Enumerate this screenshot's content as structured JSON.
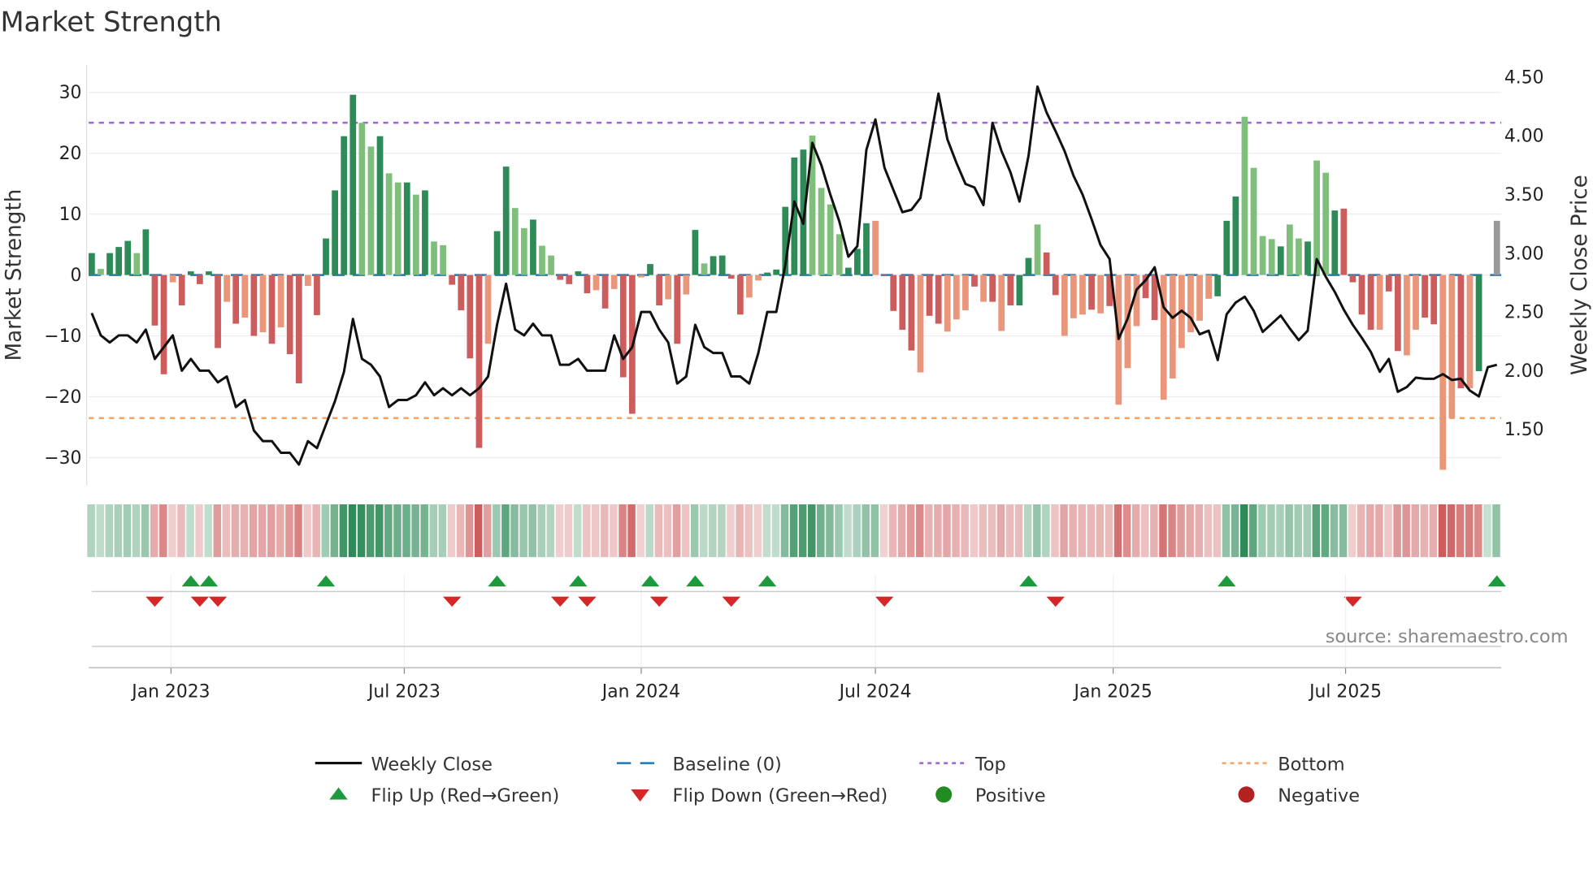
{
  "chart_data": {
    "type": "bar",
    "title": "Market Strength",
    "ylabel": "Market Strength",
    "y2label": "Weekly Close Price",
    "ylim": [
      -35,
      32
    ],
    "y2lim": [
      1.1,
      4.6
    ],
    "y_ticks": [
      "30",
      "20",
      "10",
      "0",
      "−10",
      "−20",
      "−30"
    ],
    "y_tick_values": [
      30,
      20,
      10,
      0,
      -10,
      -20,
      -30
    ],
    "y2_ticks": [
      "4.50",
      "4.00",
      "3.50",
      "3.00",
      "2.50",
      "2.00",
      "1.50"
    ],
    "y2_tick_values": [
      4.5,
      4.0,
      3.5,
      3.0,
      2.5,
      2.0,
      1.5
    ],
    "x_ticks": [
      {
        "label": "Jan 2023",
        "week": 8.8
      },
      {
        "label": "Jul 2023",
        "week": 34.7
      },
      {
        "label": "Jan 2024",
        "week": 61.0
      },
      {
        "label": "Jul 2024",
        "week": 87.0
      },
      {
        "label": "Jan 2025",
        "week": 113.4
      },
      {
        "label": "Jul 2025",
        "week": 139.2
      }
    ],
    "top_level": 25,
    "bottom_level": -23.5,
    "baseline": 0,
    "strength": [
      3.6,
      1.0,
      3.6,
      4.6,
      5.6,
      3.6,
      7.5,
      -8.3,
      -16.3,
      -1.2,
      -5,
      0.6,
      -1.5,
      0.6,
      -12,
      -4.4,
      -8,
      -7,
      -10,
      -9.4,
      -11.3,
      -8.6,
      -13,
      -17.8,
      -1.8,
      -6.6,
      6,
      13.9,
      22.8,
      29.6,
      25,
      21.1,
      22.8,
      16.7,
      15.2,
      15.2,
      13.2,
      13.9,
      5.5,
      4.9,
      -1.6,
      -5.8,
      -13.7,
      -28.4,
      -11.3,
      7.2,
      17.8,
      11,
      7.7,
      9.1,
      4.8,
      3.2,
      -0.8,
      -1.5,
      0.6,
      -3,
      -2.5,
      -5.5,
      -2.3,
      -16.8,
      -22.8,
      -0.4,
      1.8,
      -5,
      -4,
      -11.3,
      -3.2,
      7.4,
      1.9,
      3.1,
      3.2,
      -0.6,
      -6.5,
      -3.7,
      -0.9,
      0.4,
      0.9,
      11.2,
      19.3,
      20.6,
      22.9,
      14.3,
      11.6,
      6.7,
      1.2,
      4.3,
      8.5,
      8.9,
      -0.2,
      -5.9,
      -9,
      -12.4,
      -16,
      -6.7,
      -8,
      -9.3,
      -7.3,
      -5.8,
      -1.9,
      -4.4,
      -4.4,
      -9.2,
      -5,
      -5,
      2.8,
      8.3,
      3.7,
      -3.3,
      -10,
      -7.1,
      -6.5,
      -5.7,
      -6.3,
      -5.1,
      -21.3,
      -15.3,
      -8.4,
      -3.8,
      -7.4,
      -20.5,
      -17,
      -12,
      -9.4,
      -7.5,
      -3.9,
      -3.5,
      8.9,
      12.9,
      26,
      17.6,
      6.4,
      5.9,
      4.7,
      8.3,
      6,
      5.5,
      18.8,
      16.8,
      10.6,
      10.9,
      -1.2,
      -6.5,
      -9,
      -9,
      -2.7,
      -12.5,
      -13.2,
      -9,
      -7,
      -8.1,
      -32,
      -23.5,
      -18.6,
      -18.6,
      -15.8,
      0,
      8.9
    ],
    "bar_shade": "DLDDDLDRRSRDRDRSRSRSRSRRSRDDDDLLDLLDLDLLRRRRSDDLLDLLRRDRSRSRRSDRSRSDLDDRRSSDDDDDLLLLDDDSRRRRSRRSSSRSRSRDDLRRSSSRSRSSSRRSSSSSSDDDLLLLDLLDLLDRRRRSRRSSRRSSRSD",
    "weekly_close": [
      2.49,
      2.3,
      2.24,
      2.3,
      2.3,
      2.24,
      2.35,
      2.1,
      2.2,
      2.3,
      2.0,
      2.1,
      2.0,
      2.0,
      1.9,
      1.95,
      1.69,
      1.75,
      1.49,
      1.4,
      1.4,
      1.3,
      1.3,
      1.2,
      1.4,
      1.34,
      1.54,
      1.74,
      1.99,
      2.44,
      2.1,
      2.05,
      1.95,
      1.69,
      1.75,
      1.75,
      1.79,
      1.9,
      1.79,
      1.85,
      1.79,
      1.85,
      1.79,
      1.85,
      1.95,
      2.39,
      2.74,
      2.35,
      2.3,
      2.4,
      2.3,
      2.3,
      2.05,
      2.05,
      2.1,
      2.0,
      2.0,
      2.0,
      2.3,
      2.1,
      2.2,
      2.5,
      2.5,
      2.35,
      2.24,
      1.89,
      1.95,
      2.39,
      2.2,
      2.15,
      2.15,
      1.95,
      1.95,
      1.89,
      2.15,
      2.5,
      2.5,
      2.9,
      3.44,
      3.25,
      3.94,
      3.75,
      3.5,
      3.27,
      2.97,
      3.06,
      3.88,
      4.14,
      3.73,
      3.54,
      3.35,
      3.37,
      3.47,
      3.92,
      4.36,
      3.97,
      3.77,
      3.59,
      3.56,
      3.41,
      4.11,
      3.87,
      3.69,
      3.44,
      3.83,
      4.42,
      4.2,
      4.04,
      3.87,
      3.66,
      3.5,
      3.29,
      3.07,
      2.95,
      2.27,
      2.44,
      2.69,
      2.77,
      2.88,
      2.54,
      2.45,
      2.51,
      2.45,
      2.31,
      2.34,
      2.09,
      2.48,
      2.58,
      2.63,
      2.51,
      2.33,
      2.4,
      2.47,
      2.36,
      2.26,
      2.34,
      2.95,
      2.8,
      2.67,
      2.52,
      2.39,
      2.28,
      2.16,
      1.99,
      2.1,
      1.82,
      1.86,
      1.94,
      1.93,
      1.93,
      1.97,
      1.92,
      1.93,
      1.83,
      1.78,
      2.03,
      2.05
    ],
    "flip_up_weeks": [
      11,
      13,
      26,
      45,
      54,
      62,
      67,
      75,
      104,
      126,
      156
    ],
    "flip_down_weeks": [
      7,
      12,
      14,
      40,
      52,
      55,
      63,
      71,
      88,
      107,
      140
    ],
    "legend": {
      "placement": "bottom",
      "items": [
        "Weekly Close",
        "Baseline (0)",
        "Top",
        "Bottom",
        "Flip Up (Red→Green)",
        "Flip Down (Green→Red)",
        "Positive",
        "Negative"
      ]
    },
    "source": "source: sharemaestro.com"
  },
  "colors": {
    "strong_pos": "#2e8b57",
    "weak_pos": "#7fbf7b",
    "strong_neg": "#cd5c5c",
    "weak_neg": "#e9967a",
    "close_line": "#111111",
    "baseline": "#1f77b4",
    "top": "#a062d8",
    "bottom": "#f4a460",
    "flip_up": "#1e9a3e",
    "flip_down": "#d62728",
    "positive_dot": "#228b22",
    "negative_dot": "#b22222"
  }
}
